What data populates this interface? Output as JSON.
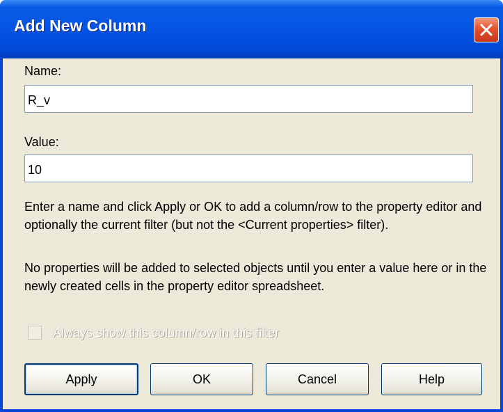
{
  "window": {
    "title": "Add New Column"
  },
  "form": {
    "name_label": "Name:",
    "name_value": "R_v",
    "value_label": "Value:",
    "value_value": "10"
  },
  "help": {
    "paragraph1": "Enter a name and click Apply or OK to add a column/row to the property editor and optionally the current filter (but not the <Current properties> filter).",
    "paragraph2": "No properties will be added to selected objects until you enter a value here or in the newly created cells in the property editor spreadsheet."
  },
  "options": {
    "always_show_label": "Always show this column/row in this filter",
    "always_show_checked": false,
    "always_show_enabled": false
  },
  "buttons": {
    "apply": "Apply",
    "ok": "OK",
    "cancel": "Cancel",
    "help": "Help"
  },
  "colors": {
    "titlebar": "#0554e3",
    "dialog_background": "#ece9d8",
    "close_button": "#e2522f",
    "disabled_text": "#aca899"
  }
}
